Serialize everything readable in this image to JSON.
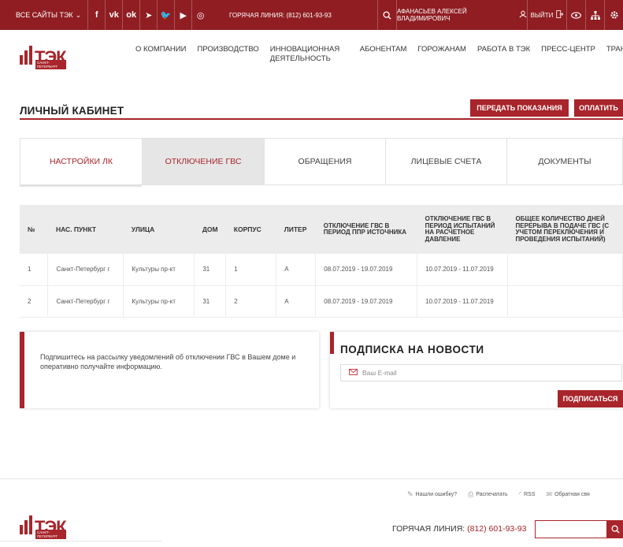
{
  "topbar": {
    "all_sites": "ВСЕ САЙТЫ ТЭК",
    "social_icons": [
      "facebook-icon",
      "vk-icon",
      "odnoklassniki-icon",
      "telegram-icon",
      "twitter-icon",
      "youtube-icon",
      "instagram-icon"
    ],
    "social_glyphs": [
      "f",
      "vk",
      "ok",
      "➤",
      "🐦",
      "▶",
      "◎"
    ],
    "hotline": "ГОРЯЧАЯ ЛИНИЯ: (812) 601-93-93",
    "user": "АФАНАСЬЕВ АЛЕКСЕЙ ВЛАДИМИРОВИЧ",
    "logout": "ВЫЙТИ"
  },
  "logo": {
    "word": "ТЭК",
    "sub": "САНКТ-ПЕТЕРБУРГ"
  },
  "nav": {
    "items": [
      "О КОМПАНИИ",
      "ПРОИЗВОДСТВО",
      "ИННОВАЦИОННАЯ ДЕЯТЕЛЬНОСТЬ",
      "АБОНЕНТАМ",
      "ГОРОЖАНАМ",
      "РАБОТА В ТЭК",
      "ПРЕСС-ЦЕНТР",
      "ТРАНСПОР"
    ]
  },
  "page": {
    "title": "ЛИЧНЫЙ КАБИНЕТ",
    "submit_readings": "ПЕРЕДАТЬ ПОКАЗАНИЯ",
    "pay": "ОПЛАТИТЬ"
  },
  "tabs": [
    "НАСТРОЙКИ ЛК",
    "ОТКЛЮЧЕНИЕ ГВС",
    "ОБРАЩЕНИЯ",
    "ЛИЦЕВЫЕ СЧЕТА",
    "ДОКУМЕНТЫ"
  ],
  "table": {
    "headers": [
      "№",
      "НАС. ПУНКТ",
      "УЛИЦА",
      "ДОМ",
      "КОРПУС",
      "ЛИТЕР",
      "ОТКЛЮЧЕНИЕ ГВС В ПЕРИОД ППР ИСТОЧНИКА",
      "ОТКЛЮЧЕНИЕ ГВС В ПЕРИОД ИСПЫТАНИЙ НА РАСЧЕТНОЕ ДАВЛЕНИЕ",
      "ОБЩЕЕ КОЛИЧЕСТВО ДНЕЙ ПЕРЕРЫВА В ПОДАЧЕ ГВС (С УЧЕТОМ ПЕРЕКЛЮЧЕНИЯ И ПРОВЕДЕНИЯ ИСПЫТАНИЙ)"
    ],
    "rows": [
      [
        "1",
        "Санкт-Петербург г",
        "Культуры пр-кт",
        "31",
        "1",
        "А",
        "08.07.2019 - 19.07.2019",
        "10.07.2019 - 11.07.2019",
        ""
      ],
      [
        "2",
        "Санкт-Петербург г",
        "Культуры пр-кт",
        "31",
        "2",
        "А",
        "08.07.2019 - 19.07.2019",
        "10.07.2019 - 11.07.2019",
        ""
      ]
    ]
  },
  "notice": {
    "text": "Подпишитесь на рассылку уведомлений об отключении ГВС в Вашем доме и оперативно получайте информацию."
  },
  "subscribe": {
    "title": "ПОДПИСКА НА НОВОСТИ",
    "placeholder": "Ваш E-mail",
    "button": "ПОДПИСАТЬСЯ"
  },
  "footer": {
    "links": [
      "Нашли ошибку?",
      "Распечатать",
      "RSS",
      "Обратная свя"
    ],
    "link_icons": [
      "pencil-icon",
      "printer-icon",
      "rss-icon",
      "envelope-icon"
    ],
    "hotline_label": "ГОРЯЧАЯ ЛИНИЯ:",
    "hotline_number": "(812) 601-93-93"
  },
  "colors": {
    "brand": "#a8252b",
    "topbar": "#8f1d22"
  }
}
